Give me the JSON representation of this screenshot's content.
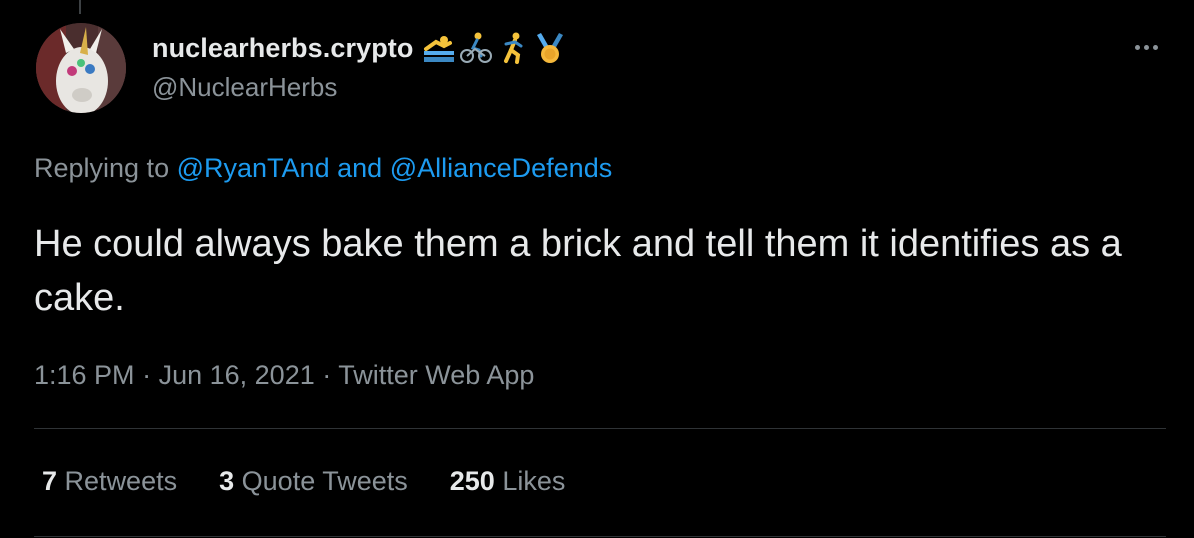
{
  "tweet": {
    "author": {
      "display_name": "nuclearherbs.crypto",
      "handle": "@NuclearHerbs",
      "avatar_icon": "unicorn-mask-avatar",
      "emojis": [
        "swimmer-icon",
        "cyclist-icon",
        "runner-icon",
        "medal-icon"
      ]
    },
    "replying_prefix": "Replying to",
    "replying_to": [
      "@RyanTAnd",
      "@AllianceDefends"
    ],
    "replying_conjunction": "and",
    "text": "He could always bake them a brick and tell them it identifies as a cake.",
    "time": "1:16 PM",
    "date": "Jun 16, 2021",
    "separator": "·",
    "source": "Twitter Web App",
    "stats": {
      "retweets_count": "7",
      "retweets_label": "Retweets",
      "quote_count": "3",
      "quote_label": "Quote Tweets",
      "likes_count": "250",
      "likes_label": "Likes"
    }
  },
  "colors": {
    "background": "#000000",
    "primary_text": "#e7e9ea",
    "secondary_text": "#8b9399",
    "link": "#1d9bf0",
    "divider": "#2f3336"
  }
}
